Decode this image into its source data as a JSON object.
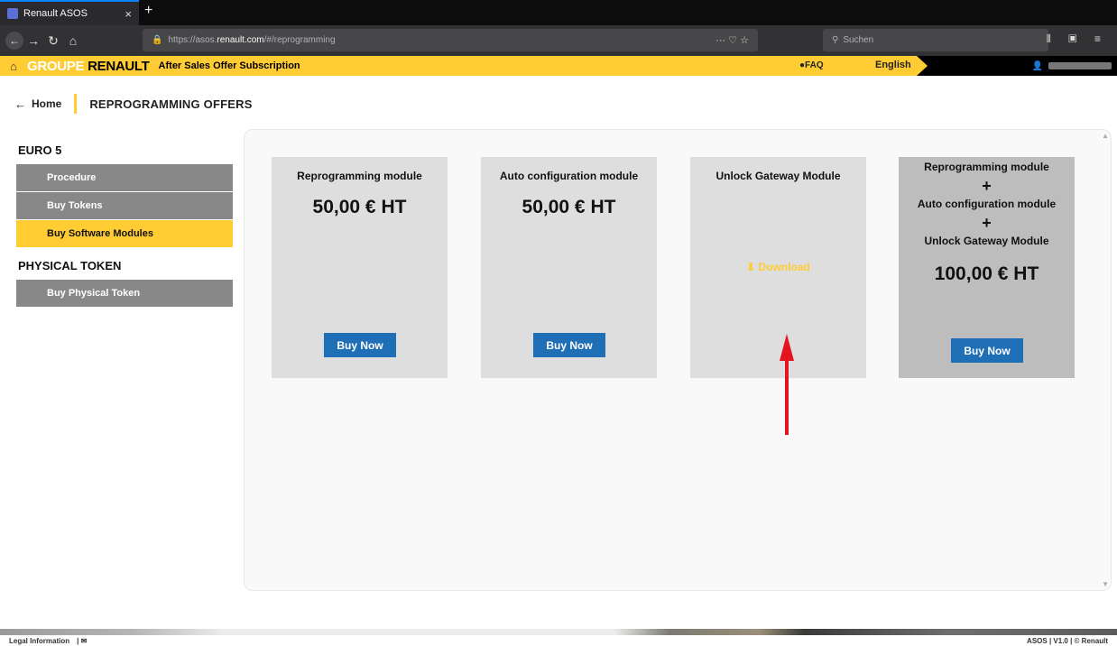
{
  "browser": {
    "tab_title": "Renault ASOS",
    "tab_close": "×",
    "new_tab": "+",
    "url_prefix": "https://asos.",
    "url_domain": "renault.com",
    "url_path": "/#/reprogramming",
    "search_placeholder": "Suchen"
  },
  "header": {
    "brand_groupe": "GROUPE",
    "brand_renault": "RENAULT",
    "subscription": "After Sales Offer Subscription",
    "faq": "FAQ",
    "language": "English"
  },
  "breadcrumb": {
    "home": "Home",
    "page_title": "REPROGRAMMING OFFERS"
  },
  "sidebar": {
    "sections": [
      {
        "title": "EURO 5",
        "items": [
          {
            "label": "Procedure"
          },
          {
            "label": "Buy Tokens"
          },
          {
            "label": "Buy Software Modules",
            "active": true
          }
        ]
      },
      {
        "title": "PHYSICAL TOKEN",
        "items": [
          {
            "label": "Buy Physical Token"
          }
        ]
      }
    ]
  },
  "cards": [
    {
      "title": "Reprogramming module",
      "price": "50,00 € HT",
      "button": "Buy Now"
    },
    {
      "title": "Auto configuration module",
      "price": "50,00 € HT",
      "button": "Buy Now"
    },
    {
      "title": "Unlock Gateway Module",
      "download": "Download"
    }
  ],
  "combo": {
    "line1": "Reprogramming module",
    "plus": "+",
    "line2": "Auto configuration module",
    "line3": "Unlock Gateway Module",
    "price": "100,00 € HT",
    "button": "Buy Now"
  },
  "footer": {
    "legal": "Legal Information",
    "version": "ASOS  |  V1.0  |  © Renault"
  },
  "colors": {
    "accent": "#ffcc33",
    "button_blue": "#1f6fb6",
    "sidebar_gray": "#888888",
    "arrow_red": "#e4151f"
  }
}
